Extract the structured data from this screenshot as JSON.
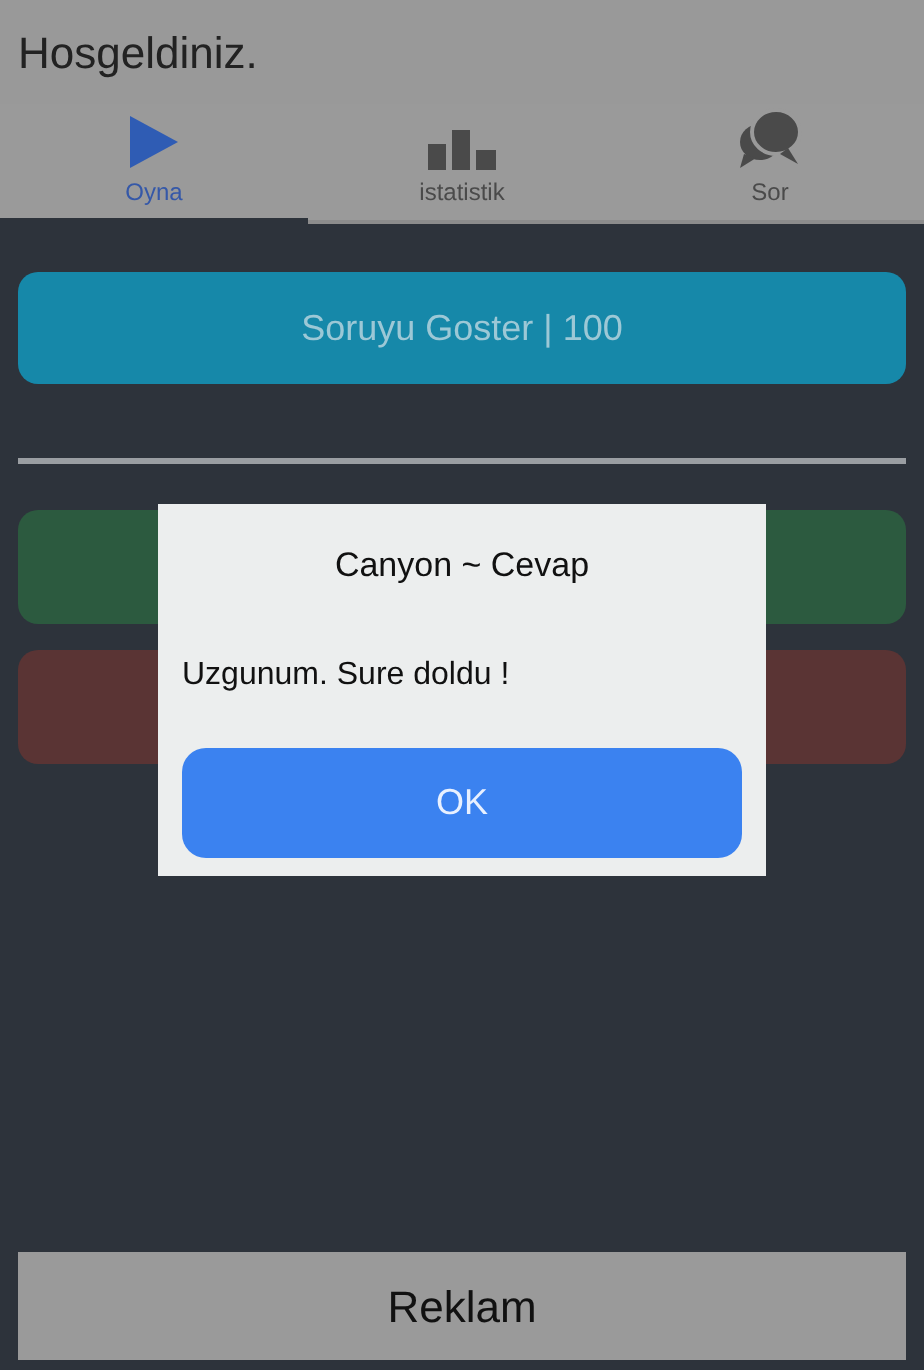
{
  "header": {
    "title": "Hosgeldiniz."
  },
  "tabs": [
    {
      "label": "Oyna",
      "selected": true
    },
    {
      "label": "istatistik",
      "selected": false
    },
    {
      "label": "Sor",
      "selected": false
    }
  ],
  "question_button": {
    "label": "Soruyu Goster | 100"
  },
  "answer_buttons": [
    {
      "color": "#2c5a3f"
    },
    {
      "color": "#5a3434"
    }
  ],
  "dialog": {
    "title": "Canyon ~ Cevap",
    "message": "Uzgunum. Sure doldu !",
    "button": "OK"
  },
  "ad_bar": {
    "label": "Reklam"
  }
}
